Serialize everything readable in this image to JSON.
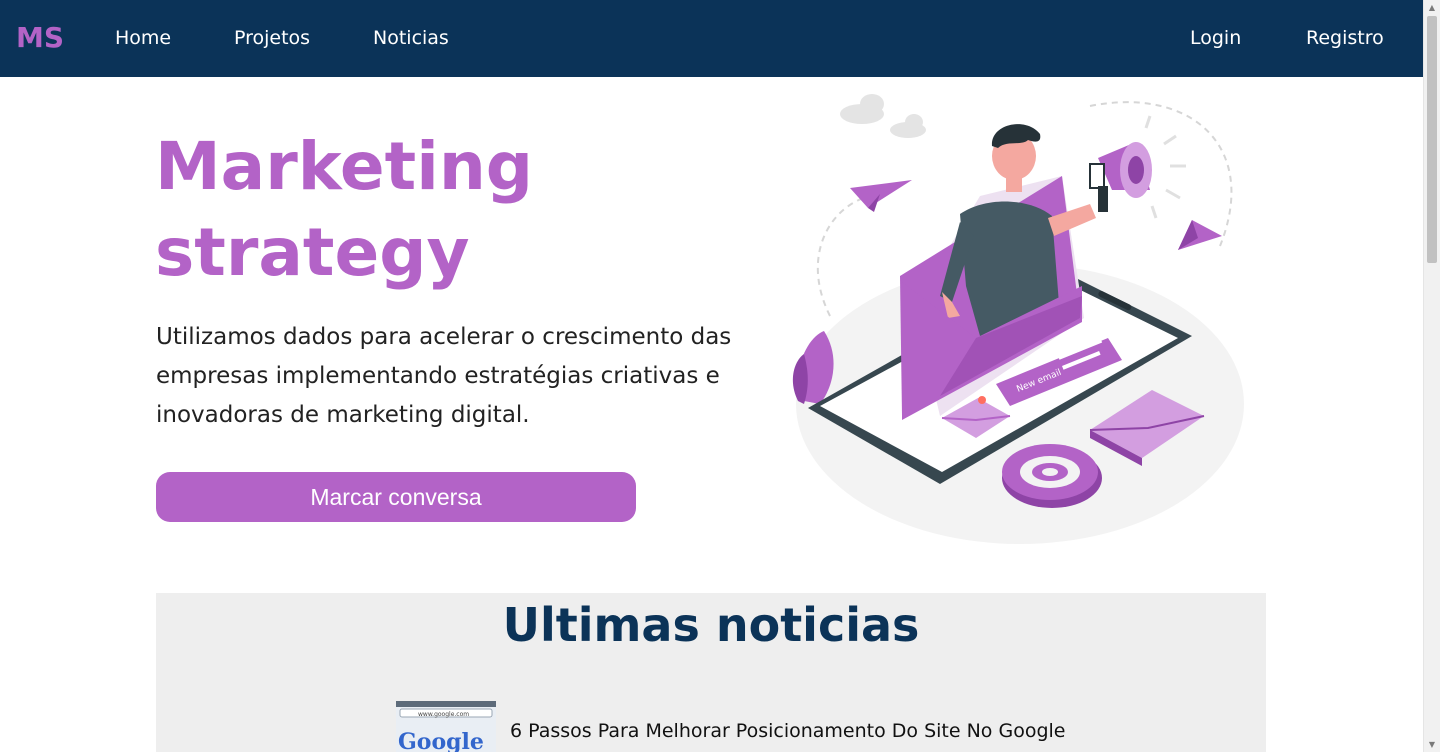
{
  "nav": {
    "logo": "MS",
    "links": [
      "Home",
      "Projetos",
      "Noticias"
    ],
    "login": "Login",
    "register": "Registro"
  },
  "hero": {
    "title_line1": "Marketing",
    "title_line2": "strategy",
    "description": "Utilizamos dados para acelerar o crescimento das empresas implementando estratégias criativas e inovadoras de marketing digital.",
    "cta": "Marcar conversa"
  },
  "illustration": {
    "label": "New email",
    "icons": [
      "megaphone-icon",
      "envelope-icon",
      "at-sign-icon",
      "paper-plane-icon",
      "cloud-icon",
      "tablet-icon",
      "plant-icon"
    ]
  },
  "news": {
    "heading": "Ultimas noticias",
    "items": [
      {
        "title": "6 Passos Para Melhorar Posicionamento Do Site No Google",
        "thumb_text": "Google",
        "thumb_url": "www.google.com"
      }
    ]
  },
  "colors": {
    "navbar": "#0b3358",
    "accent": "#b363c7",
    "heading": "#0b3358",
    "section_bg": "#eeeeee"
  }
}
